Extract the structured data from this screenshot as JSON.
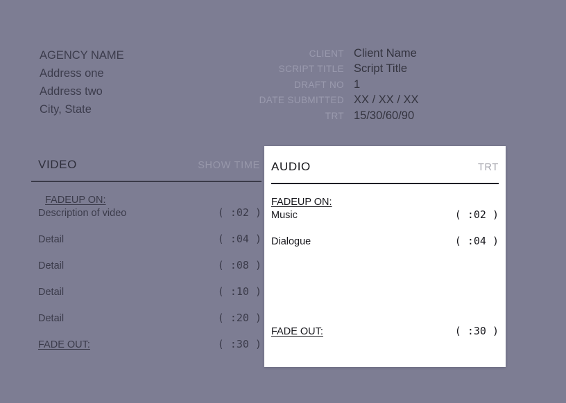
{
  "header": {
    "agency": [
      "AGENCY NAME",
      "Address one",
      "Address two",
      "City, State"
    ],
    "meta": [
      {
        "label": "CLIENT",
        "value": "Client Name"
      },
      {
        "label": "SCRIPT TITLE",
        "value": "Script Title"
      },
      {
        "label": "DRAFT NO",
        "value": "1"
      },
      {
        "label": "DATE SUBMITTED",
        "value": "XX / XX / XX"
      },
      {
        "label": "TRT",
        "value": "15/30/60/90"
      }
    ]
  },
  "video_column": {
    "title": "VIDEO",
    "time_header": "SHOW TIME",
    "open_cue": "FADEUP ON:",
    "rows": [
      {
        "label": "Description of video",
        "time": "( :02 )"
      },
      {
        "label": "Detail",
        "time": "( :04 )"
      },
      {
        "label": "Detail",
        "time": "( :08 )"
      },
      {
        "label": "Detail",
        "time": "( :10 )"
      },
      {
        "label": "Detail",
        "time": "( :20 )"
      }
    ],
    "close_row": {
      "label": "FADE OUT:",
      "time": "( :30 )"
    }
  },
  "audio_column": {
    "title": "AUDIO",
    "time_header": "TRT",
    "open_cue": "FADEUP ON:",
    "rows": [
      {
        "label": "Music",
        "time": "( :02 )"
      },
      {
        "label": "Dialogue",
        "time": "( :04 )"
      }
    ],
    "close_row": {
      "label": "FADE OUT:",
      "time": "( :30 )"
    }
  },
  "colors": {
    "background": "#7d7d93",
    "panel": "#ffffff",
    "rule_dark": "#3a3a48",
    "text_dark": "#3b3b4a",
    "text_muted": "#9a9aae"
  }
}
